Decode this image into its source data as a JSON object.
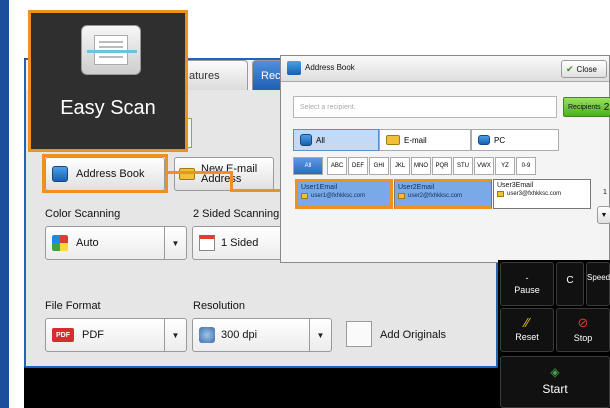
{
  "easy_scan": {
    "label": "Easy Scan"
  },
  "tabs": {
    "features": "atures",
    "recipients": "Recip"
  },
  "buttons": {
    "address_book": "Address Book",
    "new_email_line1": "New E-mail",
    "new_email_line2": "Address"
  },
  "settings": {
    "color_scanning": {
      "label": "Color Scanning",
      "value": "Auto"
    },
    "two_sided": {
      "label": "2 Sided Scanning",
      "value": "1 Sided"
    },
    "file_format": {
      "label": "File Format",
      "value": "PDF"
    },
    "resolution": {
      "label": "Resolution",
      "value": "300 dpi"
    },
    "add_originals": "Add Originals"
  },
  "dialog": {
    "title": "Address Book",
    "close": "Close",
    "search_placeholder": "Select a recipient.",
    "recipients_label": "Recipients",
    "recipients_count": "2",
    "filter_tabs": [
      "All",
      "E-mail",
      "PC"
    ],
    "alpha_index": [
      "All",
      "ABC",
      "DEF",
      "GHI",
      "JKL",
      "MNO",
      "PQR",
      "STU",
      "VWX",
      "YZ",
      "0-9"
    ],
    "entries": [
      {
        "name": "User1Email",
        "email": "user1@fxhkksc.com",
        "selected": true
      },
      {
        "name": "User2Email",
        "email": "user2@fxhkksc.com",
        "selected": true
      },
      {
        "name": "User3Email",
        "email": "user3@fxhkksc.com",
        "selected": false
      }
    ],
    "scroll_page": "1"
  },
  "keys": {
    "pause": "Pause",
    "clear": "C",
    "speed_dial": "Speed Dial",
    "reset": "Reset",
    "stop": "Stop",
    "start": "Start"
  },
  "icons": {
    "address_book": "address-book-icon",
    "email": "email-icon",
    "pc": "pc-icon",
    "pdf": "pdf-icon",
    "start": "start-icon",
    "stop": "stop-icon",
    "reset": "reset-icon"
  },
  "colors": {
    "accent": "#1e64b8",
    "highlight": "#f0901e",
    "recipients": "#4caf1f"
  }
}
